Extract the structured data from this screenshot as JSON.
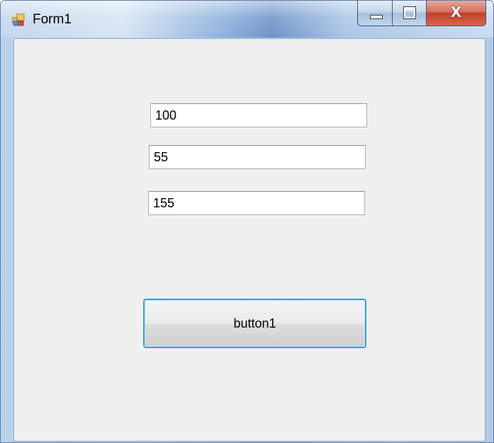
{
  "window": {
    "title": "Form1",
    "icon": "winforms-app-icon"
  },
  "caption_buttons": {
    "minimize_icon": "minimize-icon",
    "maximize_icon": "maximize-icon",
    "close_icon": "close-icon",
    "close_glyph": "X"
  },
  "form": {
    "textbox1": {
      "value": "100"
    },
    "textbox2": {
      "value": "55"
    },
    "textbox3": {
      "value": "155"
    },
    "button1": {
      "label": "button1"
    }
  },
  "colors": {
    "client_background": "#f0f0f0",
    "button_focus_border": "#3c9dd0",
    "close_button": "#c1412b"
  }
}
